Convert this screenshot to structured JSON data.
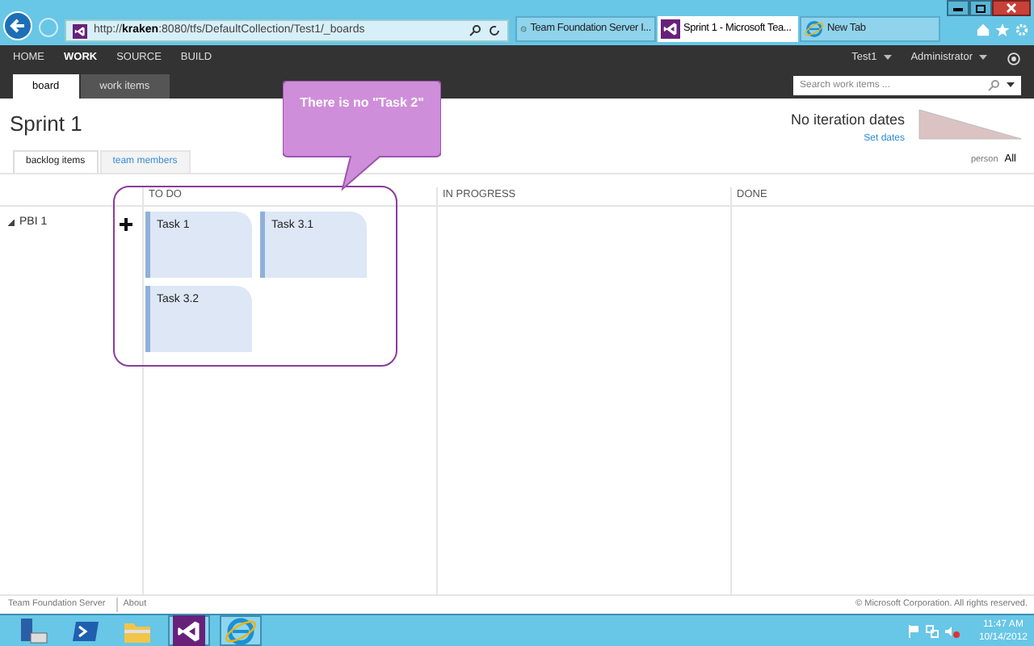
{
  "browser": {
    "address": {
      "prefix": "http://",
      "host": "kraken",
      "rest": ":8080/tfs/DefaultCollection/Test1/_boards"
    },
    "tabs": [
      {
        "label": "Team Foundation Server I...",
        "selected": false,
        "kind": "ie"
      },
      {
        "label": "Sprint 1 - Microsoft Tea...",
        "selected": true,
        "kind": "vs"
      },
      {
        "label": "New Tab",
        "selected": false,
        "kind": "ie"
      }
    ]
  },
  "nav": {
    "items": [
      {
        "label": "HOME",
        "selected": false
      },
      {
        "label": "WORK",
        "selected": true
      },
      {
        "label": "SOURCE",
        "selected": false
      },
      {
        "label": "BUILD",
        "selected": false
      }
    ],
    "project": "Test1",
    "user": "Administrator"
  },
  "subtabs": [
    {
      "label": "board",
      "selected": true
    },
    {
      "label": "work items",
      "selected": false
    }
  ],
  "search": {
    "placeholder": "Search work items ..."
  },
  "page": {
    "title": "Sprint 1",
    "iteration_status": "No iteration dates",
    "set_dates": "Set dates"
  },
  "view_tabs": [
    {
      "label": "backlog items",
      "selected": true
    },
    {
      "label": "team members",
      "selected": false
    }
  ],
  "person_filter": {
    "label": "person",
    "value": "All"
  },
  "board": {
    "columns": [
      "TO DO",
      "IN PROGRESS",
      "DONE"
    ],
    "rows": [
      {
        "title": "PBI 1",
        "expanded": true,
        "cells": [
          [
            "Task 1",
            "Task 3.1",
            "Task 3.2"
          ],
          [],
          []
        ]
      }
    ]
  },
  "callout": {
    "text": "There is no \"Task 2\""
  },
  "footer": {
    "links": [
      "Team Foundation Server",
      "About"
    ],
    "copyright": "© Microsoft Corporation. All rights reserved."
  },
  "taskbar": {
    "apps": [
      {
        "kind": "server",
        "selected": false
      },
      {
        "kind": "shell",
        "selected": false
      },
      {
        "kind": "folder",
        "selected": false
      },
      {
        "kind": "vs",
        "selected": true
      },
      {
        "kind": "ie",
        "selected": true
      }
    ],
    "time": "11:47 AM",
    "date": "10/14/2012"
  }
}
